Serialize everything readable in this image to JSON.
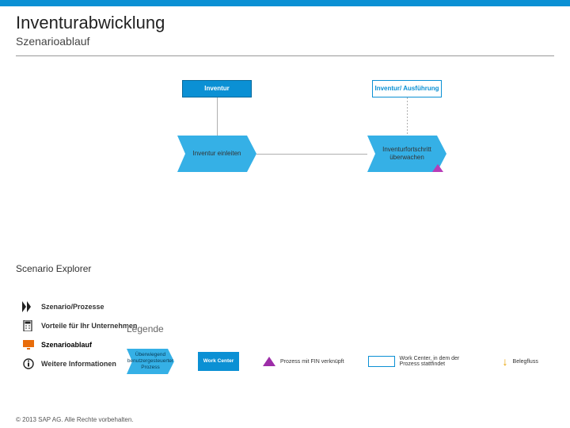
{
  "header": {
    "title": "Inventurabwicklung",
    "subtitle": "Szenarioablauf"
  },
  "diagram": {
    "top_left_label": "Inventur",
    "top_right_label": "Inventur/ Ausführung",
    "step_left": "Inventur einleiten",
    "step_right": "Inventurfortschritt überwachen"
  },
  "scenario_explorer": {
    "title": "Scenario Explorer",
    "items": [
      {
        "label": "Szenario/Prozesse"
      },
      {
        "label": "Vorteile für Ihr Unternehmen"
      },
      {
        "label": "Szenarioablauf"
      },
      {
        "label": "Weitere Informationen"
      }
    ]
  },
  "legend": {
    "title": "Legende",
    "items": [
      {
        "label": "Überwiegend benutzergesteuerter Prozess"
      },
      {
        "label": "Work Center"
      },
      {
        "label": "Prozess mit FIN verknüpft"
      },
      {
        "label": "Work Center, in dem der Prozess stattfindet"
      },
      {
        "label": "Belegfluss"
      }
    ]
  },
  "footer": "© 2013 SAP AG. Alle Rechte vorbehalten."
}
